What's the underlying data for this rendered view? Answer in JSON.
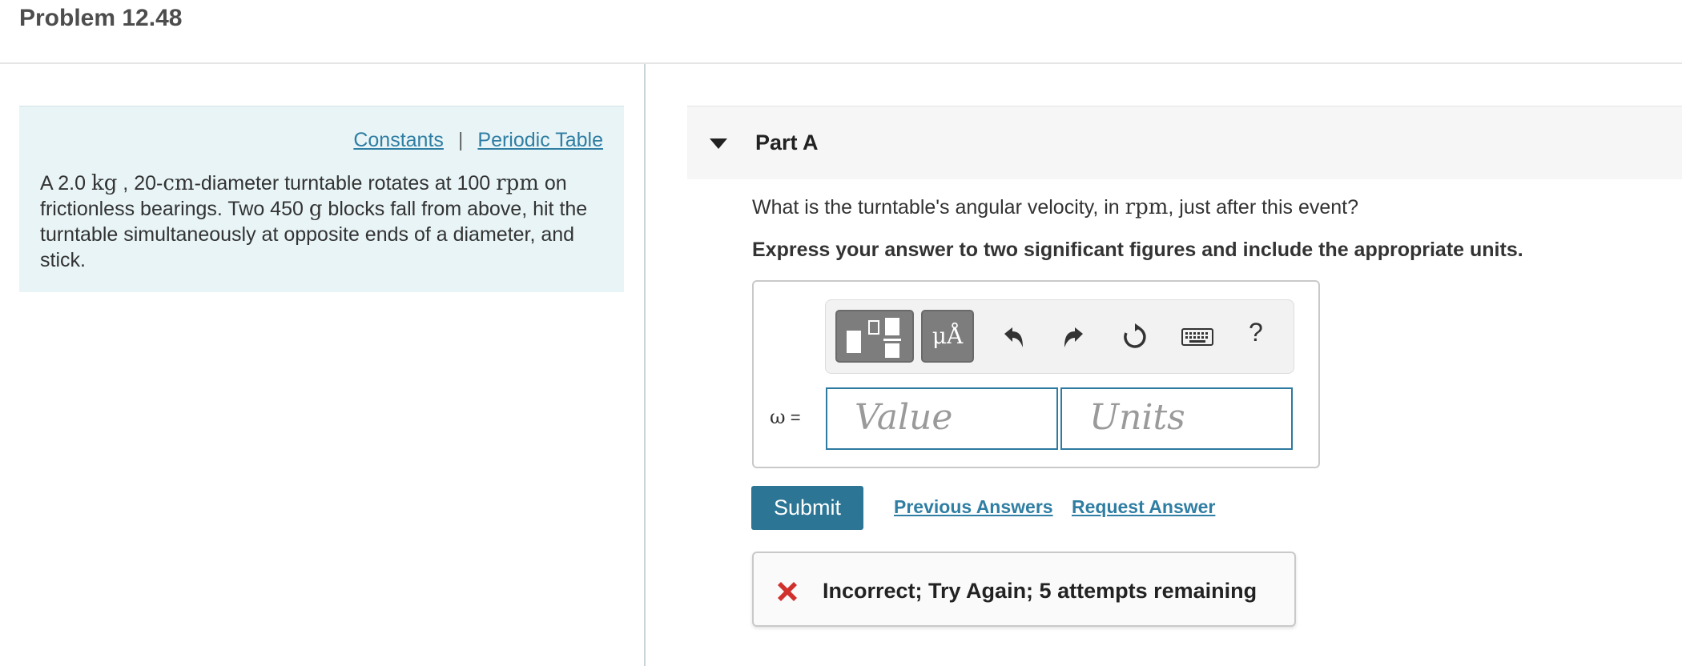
{
  "page": {
    "title": "Problem 12.48"
  },
  "info_panel": {
    "links": {
      "constants": "Constants",
      "separator": "|",
      "periodic_table": "Periodic Table"
    },
    "problem_text": {
      "part1": "A 2.0 ",
      "unit_kg": "kg",
      "part2": " , 20-",
      "unit_cm": "cm",
      "part3": "-diameter turntable rotates at 100 ",
      "unit_rpm": "rpm",
      "part4": " on frictionless bearings. Two 450 ",
      "unit_g": "g",
      "part5": " blocks fall from above, hit the turntable simultaneously at opposite ends of a diameter, and stick."
    }
  },
  "part": {
    "title": "Part A",
    "question_part1": "What is the turntable's angular velocity, in ",
    "question_unit": "rpm",
    "question_part2": ", just after this event?",
    "instructions": "Express your answer to two significant figures and include the appropriate units."
  },
  "answer": {
    "toolbar": {
      "templates_icon": "templates-icon",
      "units_label": "μÅ",
      "undo_icon": "undo-icon",
      "redo_icon": "redo-icon",
      "reset_icon": "reset-icon",
      "keyboard_icon": "keyboard-icon",
      "help_label": "?"
    },
    "variable_symbol": "ω",
    "equals": " =",
    "value_placeholder": "Value",
    "units_placeholder": "Units"
  },
  "actions": {
    "submit_label": "Submit",
    "previous_answers_label": "Previous Answers",
    "request_answer_label": "Request Answer"
  },
  "feedback": {
    "message": "Incorrect; Try Again; 5 attempts remaining",
    "status_color": "#d0312d"
  },
  "colors": {
    "accent": "#2c7595",
    "link": "#2f7ea3",
    "info_panel_bg": "#e8f4f6"
  }
}
